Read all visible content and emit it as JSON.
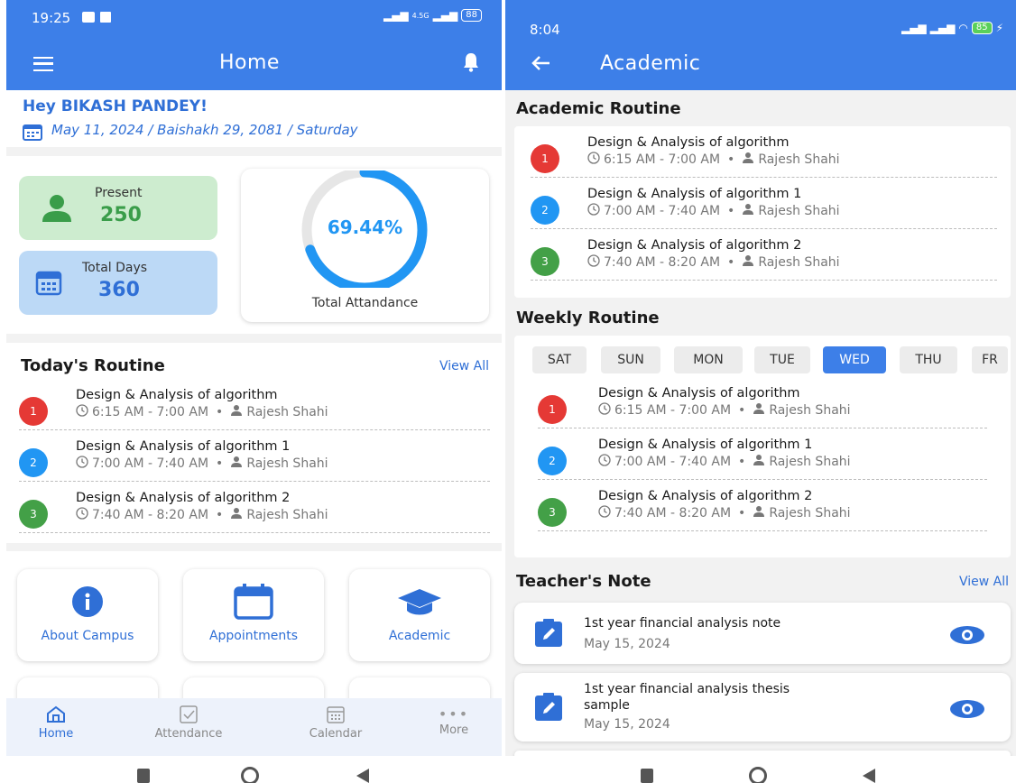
{
  "colors": {
    "primary": "#3d7fe8",
    "red": "#e53935",
    "blue": "#2196f3",
    "green": "#43a047"
  },
  "left": {
    "status": {
      "time": "19:25",
      "signal": "4.5G",
      "battery": "88"
    },
    "appbar": {
      "title": "Home"
    },
    "greeting": "Hey BIKASH PANDEY!",
    "date": "May 11, 2024 / Baishakh 29, 2081 / Saturday",
    "present": {
      "label": "Present",
      "value": "250"
    },
    "total_days": {
      "label": "Total Days",
      "value": "360"
    },
    "attendance": {
      "percent_text": "69.44%",
      "fraction": 0.6944,
      "label": "Total Attandance"
    },
    "todays_routine": {
      "title": "Today's Routine",
      "view_all": "View All",
      "items": [
        {
          "num": "1",
          "name": "Design & Analysis of algorithm",
          "time": "6:15 AM - 7:00 AM",
          "teacher": "Rajesh Shahi"
        },
        {
          "num": "2",
          "name": "Design & Analysis of algorithm 1",
          "time": "7:00 AM - 7:40 AM",
          "teacher": "Rajesh Shahi"
        },
        {
          "num": "3",
          "name": "Design & Analysis of algorithm 2",
          "time": "7:40 AM - 8:20 AM",
          "teacher": "Rajesh Shahi"
        }
      ]
    },
    "tiles": [
      {
        "label": "About Campus",
        "icon": "info-icon"
      },
      {
        "label": "Appointments",
        "icon": "calendar-icon"
      },
      {
        "label": "Academic",
        "icon": "graduation-cap-icon"
      }
    ],
    "nav": [
      {
        "label": "Home",
        "icon": "home-icon"
      },
      {
        "label": "Attendance",
        "icon": "check-square-icon"
      },
      {
        "label": "Calendar",
        "icon": "calendar-icon"
      },
      {
        "label": "More",
        "icon": "more-dots-icon"
      }
    ]
  },
  "right": {
    "status": {
      "time": "8:04",
      "battery": "85"
    },
    "appbar": {
      "title": "Academic"
    },
    "academic_routine": {
      "title": "Academic Routine",
      "items": [
        {
          "num": "1",
          "name": "Design & Analysis of algorithm",
          "time": "6:15 AM - 7:00 AM",
          "teacher": "Rajesh Shahi"
        },
        {
          "num": "2",
          "name": "Design & Analysis of algorithm 1",
          "time": "7:00 AM - 7:40 AM",
          "teacher": "Rajesh Shahi"
        },
        {
          "num": "3",
          "name": "Design & Analysis of algorithm 2",
          "time": "7:40 AM - 8:20 AM",
          "teacher": "Rajesh Shahi"
        }
      ]
    },
    "weekly_routine": {
      "title": "Weekly Routine",
      "days": [
        "SAT",
        "SUN",
        "MON",
        "TUE",
        "WED",
        "THU",
        "FR"
      ],
      "selected_day": "WED",
      "items": [
        {
          "num": "1",
          "name": "Design & Analysis of algorithm",
          "time": "6:15 AM - 7:00 AM",
          "teacher": "Rajesh Shahi"
        },
        {
          "num": "2",
          "name": "Design & Analysis of algorithm 1",
          "time": "7:00 AM - 7:40 AM",
          "teacher": "Rajesh Shahi"
        },
        {
          "num": "3",
          "name": "Design & Analysis of algorithm 2",
          "time": "7:40 AM - 8:20 AM",
          "teacher": "Rajesh Shahi"
        }
      ]
    },
    "teachers_note": {
      "title": "Teacher's Note",
      "view_all": "View All",
      "notes": [
        {
          "title": "1st year financial analysis note",
          "title_line2": "",
          "date": "May 15, 2024"
        },
        {
          "title": "1st year financial analysis thesis",
          "title_line2": "sample",
          "date": "May 15, 2024"
        }
      ]
    }
  }
}
